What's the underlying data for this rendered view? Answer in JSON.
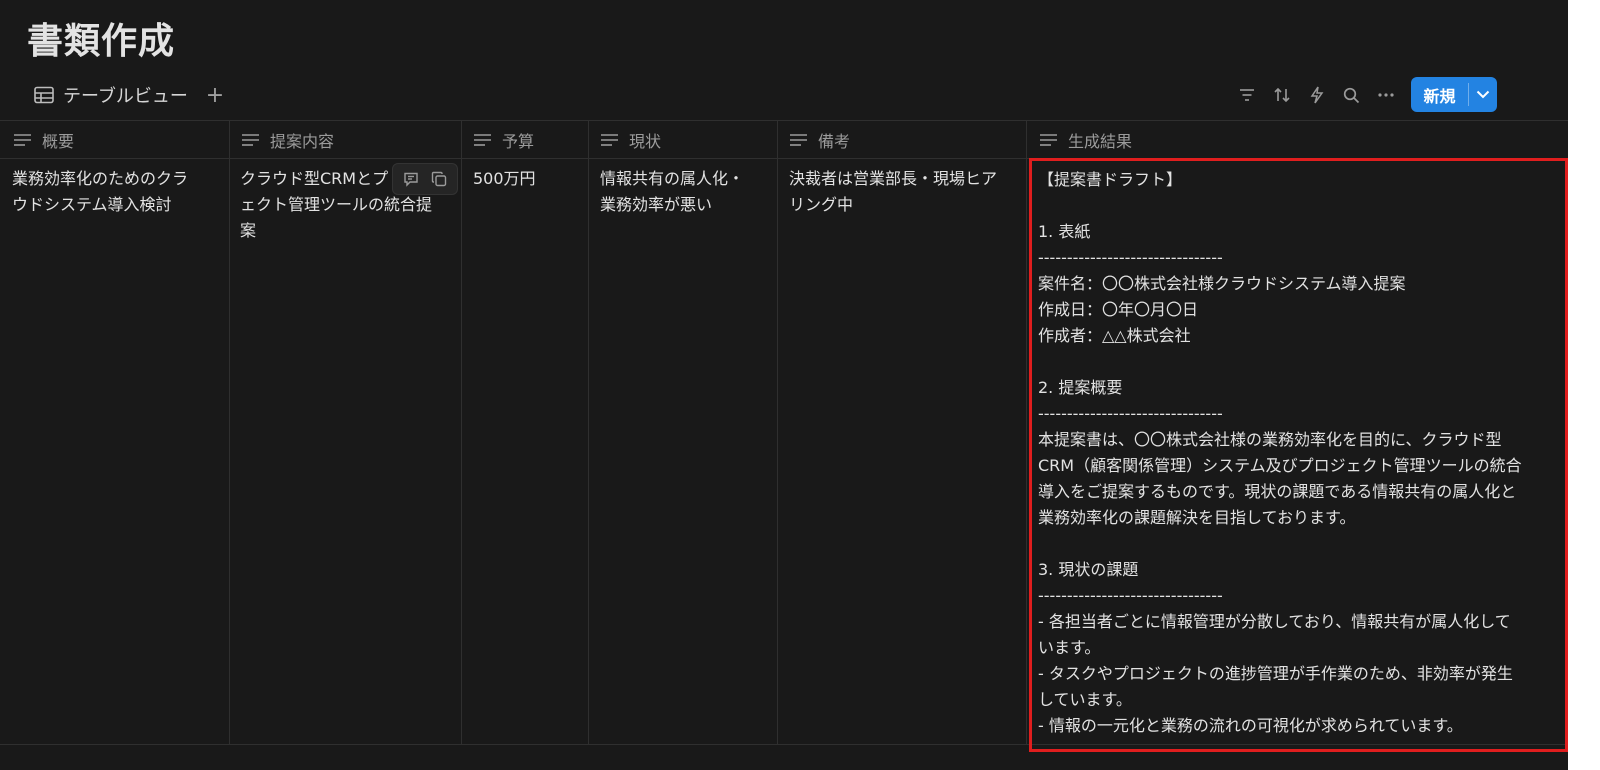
{
  "page": {
    "title": "書類作成"
  },
  "view": {
    "tab_label": "テーブルビュー",
    "add_view": "+",
    "new_button": "新規"
  },
  "toolbar_icons": [
    "filter-icon",
    "sort-icon",
    "automation-bolt-icon",
    "search-icon",
    "more-icon"
  ],
  "table": {
    "columns": [
      "概要",
      "提案内容",
      "予算",
      "現状",
      "備考",
      "生成結果"
    ],
    "row": {
      "summary": "業務効率化のためのクラ\nウドシステム導入検討",
      "proposal": "クラウド型CRMとプ\nェクト管理ツールの統合提\n案",
      "budget": "500万円",
      "status": "情報共有の属人化・\n業務効率が悪い",
      "notes": "決裁者は営業部長・現場ヒア\nリング中",
      "result": "【提案書ドラフト】\n\n1. 表紙\n--------------------------------\n案件名：〇〇株式会社様クラウドシステム導入提案\n作成日：〇年〇月〇日\n作成者：△△株式会社\n\n2. 提案概要\n--------------------------------\n本提案書は、〇〇株式会社様の業務効率化を目的に、クラウド型\nCRM（顧客関係管理）システム及びプロジェクト管理ツールの統合\n導入をご提案するものです。現状の課題である情報共有の属人化と\n業務効率化の課題解決を目指しております。\n\n3. 現状の課題\n--------------------------------\n- 各担当者ごとに情報管理が分散しており、情報共有が属人化して\nいます。\n- タスクやプロジェクトの進捗管理が手作業のため、非効率が発生\nしています。\n- 情報の一元化と業務の流れの可視化が求められています。"
    }
  },
  "colors": {
    "background": "#191919",
    "accent": "#2383e2",
    "highlight": "#e01e1e"
  }
}
